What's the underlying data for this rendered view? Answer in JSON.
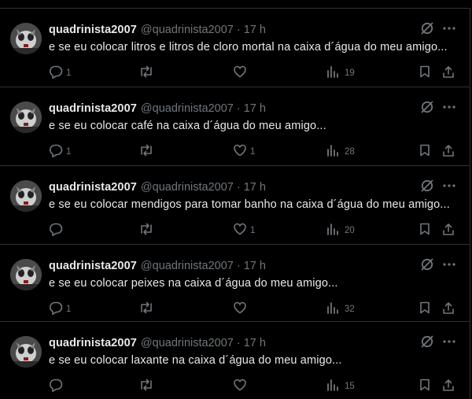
{
  "posts": [
    {
      "name": "quadrinista2007",
      "handle": "@quadrinista2007",
      "separator": "·",
      "time": "17 h",
      "text": "e se eu colocar litros e litros de cloro mortal na caixa d´água do meu amigo...",
      "replies": "1",
      "reposts": "",
      "likes": "",
      "views": "19"
    },
    {
      "name": "quadrinista2007",
      "handle": "@quadrinista2007",
      "separator": "·",
      "time": "17 h",
      "text": "e se eu colocar café na caixa d´água do meu amigo...",
      "replies": "1",
      "reposts": "",
      "likes": "1",
      "views": "28"
    },
    {
      "name": "quadrinista2007",
      "handle": "@quadrinista2007",
      "separator": "·",
      "time": "17 h",
      "text": "e se eu colocar mendigos para tomar banho na caixa d´água do meu amigo...",
      "replies": "",
      "reposts": "",
      "likes": "1",
      "views": "20"
    },
    {
      "name": "quadrinista2007",
      "handle": "@quadrinista2007",
      "separator": "·",
      "time": "17 h",
      "text": "e se eu colocar peixes na caixa d´água do meu amigo...",
      "replies": "1",
      "reposts": "",
      "likes": "",
      "views": "32"
    },
    {
      "name": "quadrinista2007",
      "handle": "@quadrinista2007",
      "separator": "·",
      "time": "17 h",
      "text": "e se eu colocar laxante na caixa d´água do meu amigo...",
      "replies": "",
      "reposts": "",
      "likes": "",
      "views": "15"
    }
  ],
  "icons": {
    "avatar": "avatar-photo",
    "grok": "grok-icon",
    "more": "more-icon",
    "reply": "reply-icon",
    "repost": "repost-icon",
    "like": "like-icon",
    "views": "views-icon",
    "bookmark": "bookmark-icon",
    "share": "share-icon"
  },
  "colors": {
    "background": "#000000",
    "text": "#e7e9ea",
    "muted": "#71767b",
    "border": "#2f3336"
  }
}
